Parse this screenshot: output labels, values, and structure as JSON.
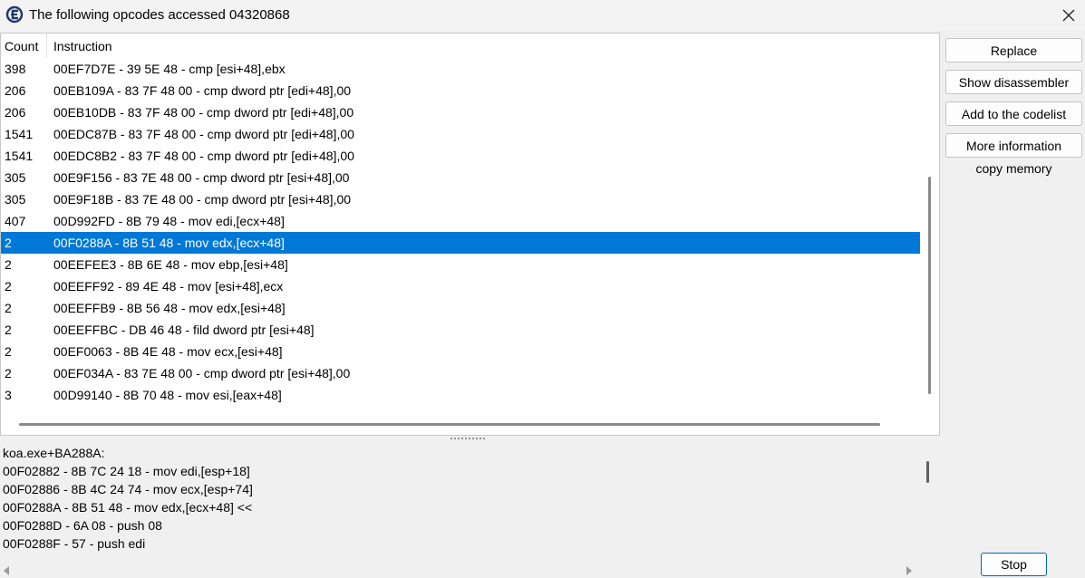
{
  "window": {
    "title": "The following opcodes accessed 04320868",
    "icon": "cheat-engine-logo",
    "close_icon": "close-icon"
  },
  "list": {
    "columns": {
      "count": "Count",
      "instruction": "Instruction"
    },
    "rows": [
      {
        "count": "398",
        "instruction": "00EF7D7E - 39 5E 48  - cmp [esi+48],ebx"
      },
      {
        "count": "206",
        "instruction": "00EB109A - 83 7F 48 00 - cmp dword ptr [edi+48],00"
      },
      {
        "count": "206",
        "instruction": "00EB10DB - 83 7F 48 00 - cmp dword ptr [edi+48],00"
      },
      {
        "count": "1541",
        "instruction": "00EDC87B - 83 7F 48 00 - cmp dword ptr [edi+48],00"
      },
      {
        "count": "1541",
        "instruction": "00EDC8B2 - 83 7F 48 00 - cmp dword ptr [edi+48],00"
      },
      {
        "count": "305",
        "instruction": "00E9F156 - 83 7E 48 00 - cmp dword ptr [esi+48],00"
      },
      {
        "count": "305",
        "instruction": "00E9F18B - 83 7E 48 00 - cmp dword ptr [esi+48],00"
      },
      {
        "count": "407",
        "instruction": "00D992FD - 8B 79 48  - mov edi,[ecx+48]"
      },
      {
        "count": "2",
        "instruction": "00F0288A - 8B 51 48  - mov edx,[ecx+48]"
      },
      {
        "count": "2",
        "instruction": "00EEFEE3 - 8B 6E 48  - mov ebp,[esi+48]"
      },
      {
        "count": "2",
        "instruction": "00EEFF92 - 89 4E 48  - mov [esi+48],ecx"
      },
      {
        "count": "2",
        "instruction": "00EEFFB9 - 8B 56 48  - mov edx,[esi+48]"
      },
      {
        "count": "2",
        "instruction": "00EEFFBC - DB 46 48  - fild dword ptr [esi+48]"
      },
      {
        "count": "2",
        "instruction": "00EF0063 - 8B 4E 48  - mov ecx,[esi+48]"
      },
      {
        "count": "2",
        "instruction": "00EF034A - 83 7E 48 00 - cmp dword ptr [esi+48],00"
      },
      {
        "count": "3",
        "instruction": "00D99140 - 8B 70 48  - mov esi,[eax+48]"
      }
    ],
    "selected_index": 8,
    "selection_color": "#0078d7"
  },
  "details": {
    "lines": [
      "koa.exe+BA288A:",
      "00F02882 - 8B 7C 24 18  - mov edi,[esp+18]",
      "00F02886 - 8B 4C 24 74  - mov ecx,[esp+74]",
      "00F0288A - 8B 51 48  - mov edx,[ecx+48] <<",
      "00F0288D - 6A 08 - push 08",
      "00F0288F - 57 - push edi"
    ]
  },
  "buttons": {
    "replace": "Replace",
    "show_disassembler": "Show disassembler",
    "add_to_codelist": "Add to the codelist",
    "more_information": "More information",
    "copy_memory": "copy memory",
    "stop": "Stop"
  }
}
